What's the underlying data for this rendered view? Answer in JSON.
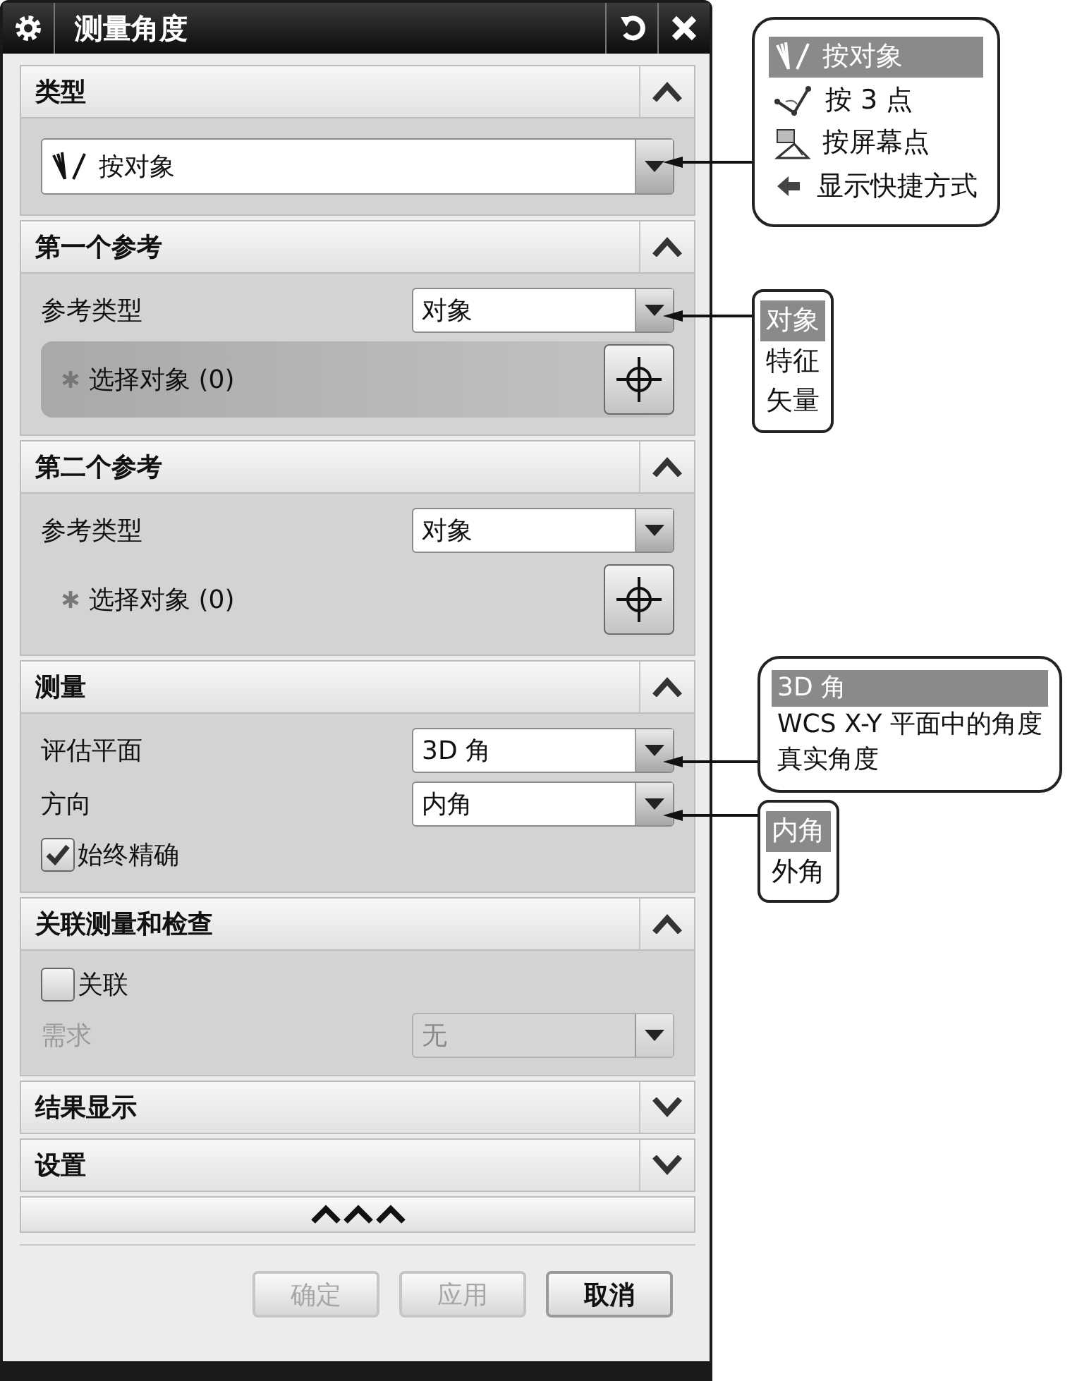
{
  "window": {
    "title": "测量角度"
  },
  "sections": [
    {
      "title": "类型",
      "expanded": true,
      "rows": [
        {
          "kind": "wide-select",
          "value": "按对象"
        }
      ]
    },
    {
      "title": "第一个参考",
      "expanded": true,
      "rows": [
        {
          "kind": "select",
          "label": "参考类型",
          "value": "对象",
          "disabled": false
        },
        {
          "kind": "selection",
          "label": "选择对象 (0)",
          "active": true
        }
      ]
    },
    {
      "title": "第二个参考",
      "expanded": true,
      "rows": [
        {
          "kind": "select",
          "label": "参考类型",
          "value": "对象",
          "disabled": false
        },
        {
          "kind": "selection",
          "label": "选择对象 (0)",
          "active": false
        }
      ]
    },
    {
      "title": "测量",
      "expanded": true,
      "rows": [
        {
          "kind": "select",
          "label": "评估平面",
          "value": "3D 角",
          "disabled": false
        },
        {
          "kind": "select",
          "label": "方向",
          "value": "内角",
          "disabled": false
        },
        {
          "kind": "checkbox",
          "label": "始终精确",
          "checked": true
        }
      ]
    },
    {
      "title": "关联测量和检查",
      "expanded": true,
      "rows": [
        {
          "kind": "checkbox",
          "label": "关联",
          "checked": false
        },
        {
          "kind": "select",
          "label": "需求",
          "value": "无",
          "disabled": true
        }
      ]
    },
    {
      "title": "结果显示",
      "expanded": false
    },
    {
      "title": "设置",
      "expanded": false
    }
  ],
  "buttons": [
    {
      "label": "确定",
      "disabled": true
    },
    {
      "label": "应用",
      "disabled": true
    },
    {
      "label": "取消",
      "disabled": false
    }
  ],
  "callouts": [
    {
      "kind": "icon-list",
      "options": [
        {
          "label": "按对象",
          "selected": true
        },
        {
          "label": "按 3 点",
          "selected": false
        },
        {
          "label": "按屏幕点",
          "selected": false
        },
        {
          "label": "显示快捷方式",
          "selected": false
        }
      ]
    },
    {
      "kind": "text-list",
      "options": [
        {
          "label": "对象",
          "selected": true
        },
        {
          "label": "特征",
          "selected": false
        },
        {
          "label": "矢量",
          "selected": false
        }
      ]
    },
    {
      "kind": "text-list",
      "options": [
        {
          "label": "3D 角",
          "selected": true
        },
        {
          "label": "WCS X-Y 平面中的角度",
          "selected": false
        },
        {
          "label": "真实角度",
          "selected": false
        }
      ]
    },
    {
      "kind": "text-list",
      "options": [
        {
          "label": "内角",
          "selected": true
        },
        {
          "label": "外角",
          "selected": false
        }
      ]
    }
  ]
}
